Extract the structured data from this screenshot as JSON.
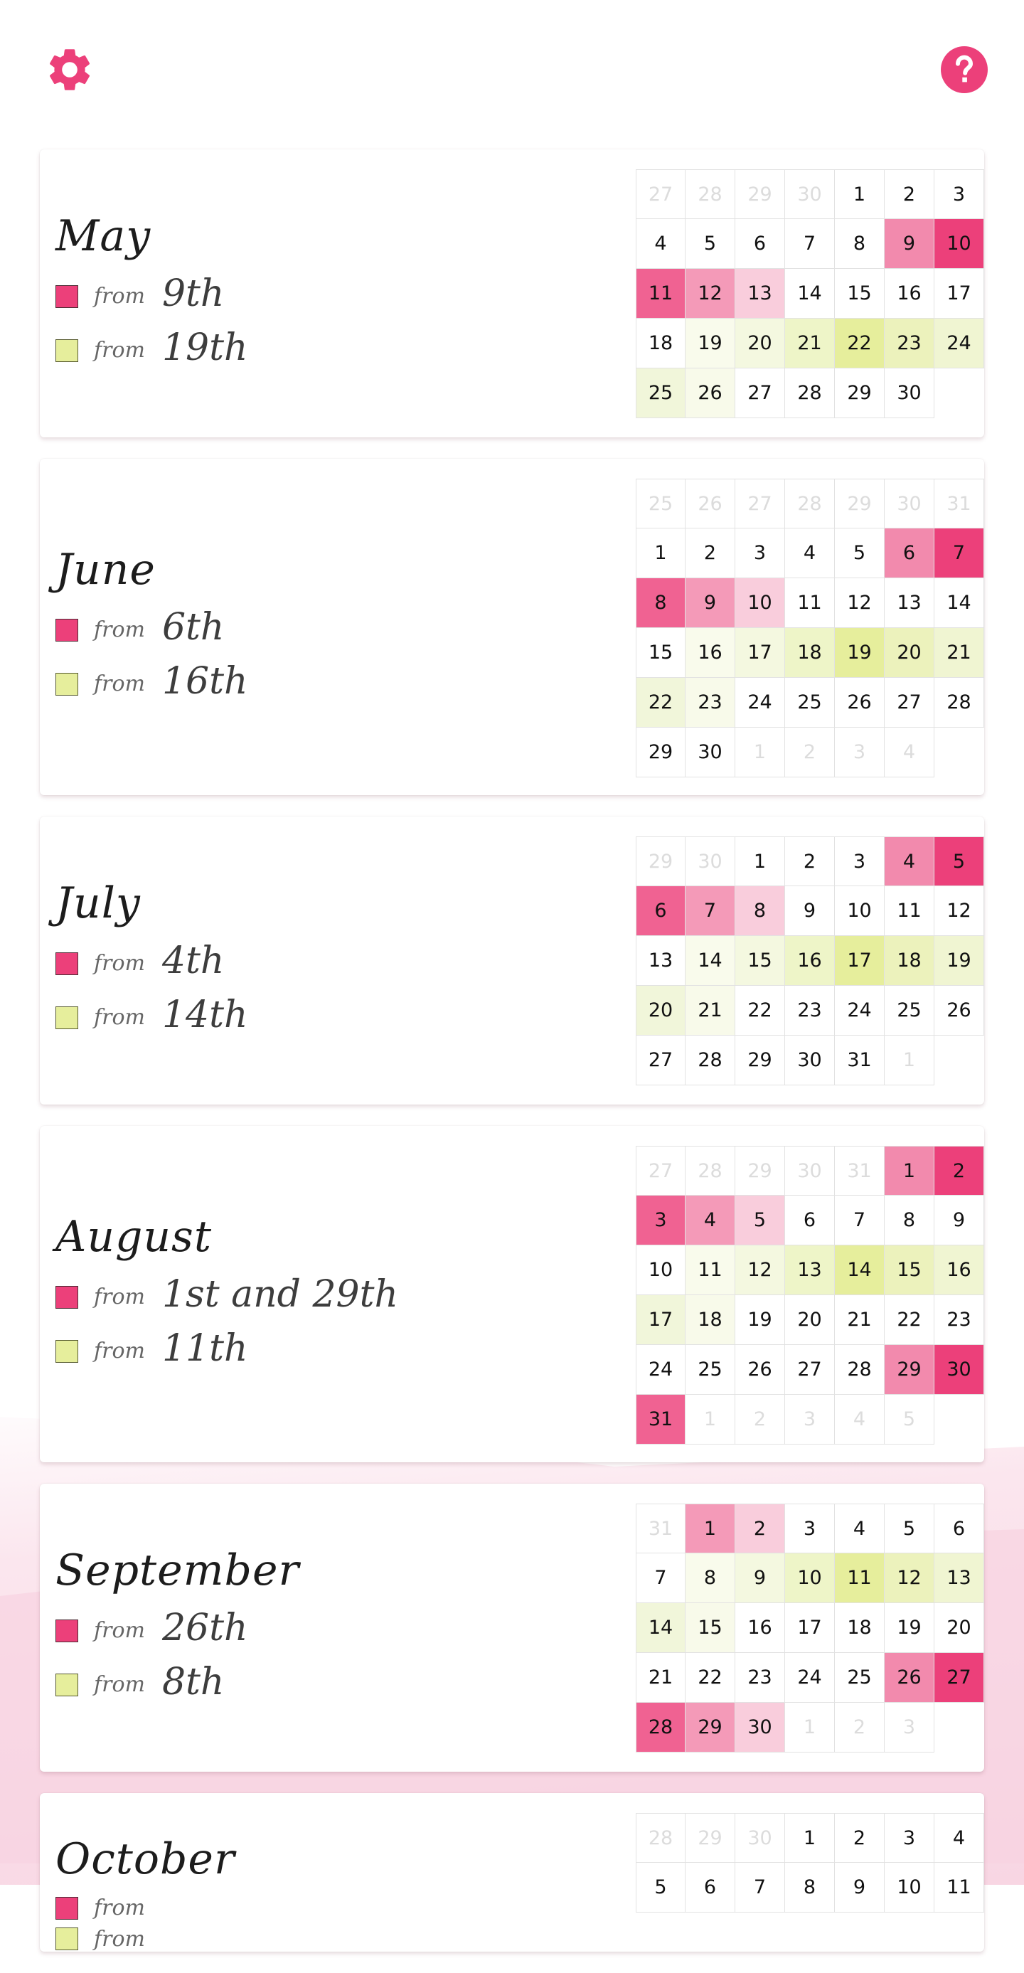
{
  "header": {
    "settings_icon": "gear-icon",
    "help_icon": "help-circle-icon",
    "accent_color": "#ec407a"
  },
  "legend_colors": {
    "pink": "#ec407a",
    "green": "#e6ee9c"
  },
  "from_label": "from",
  "months": [
    {
      "name": "May",
      "pink_from": "9th",
      "green_from": "19th",
      "weeks": [
        [
          [
            "27",
            "o"
          ],
          [
            "28",
            "o"
          ],
          [
            "29",
            "o"
          ],
          [
            "30",
            "o"
          ],
          [
            "1",
            ""
          ],
          [
            "2",
            ""
          ],
          [
            "3",
            ""
          ]
        ],
        [
          [
            "4",
            ""
          ],
          [
            "5",
            ""
          ],
          [
            "6",
            ""
          ],
          [
            "7",
            ""
          ],
          [
            "8",
            ""
          ],
          [
            "9",
            "p1"
          ],
          [
            "10",
            "p2"
          ]
        ],
        [
          [
            "11",
            "p3"
          ],
          [
            "12",
            "p4"
          ],
          [
            "13",
            "p5"
          ],
          [
            "14",
            ""
          ],
          [
            "15",
            ""
          ],
          [
            "16",
            ""
          ],
          [
            "17",
            ""
          ]
        ],
        [
          [
            "18",
            ""
          ],
          [
            "19",
            "g1"
          ],
          [
            "20",
            "g2"
          ],
          [
            "21",
            "g3"
          ],
          [
            "22",
            "g4"
          ],
          [
            "23",
            "g5"
          ],
          [
            "24",
            "g6"
          ]
        ],
        [
          [
            "25",
            "g7"
          ],
          [
            "26",
            "g8"
          ],
          [
            "27",
            ""
          ],
          [
            "28",
            ""
          ],
          [
            "29",
            ""
          ],
          [
            "30",
            ""
          ],
          [
            "",
            "e"
          ]
        ]
      ]
    },
    {
      "name": "June",
      "pink_from": "6th",
      "green_from": "16th",
      "weeks": [
        [
          [
            "25",
            "o"
          ],
          [
            "26",
            "o"
          ],
          [
            "27",
            "o"
          ],
          [
            "28",
            "o"
          ],
          [
            "29",
            "o"
          ],
          [
            "30",
            "o"
          ],
          [
            "31",
            "o"
          ]
        ],
        [
          [
            "1",
            ""
          ],
          [
            "2",
            ""
          ],
          [
            "3",
            ""
          ],
          [
            "4",
            ""
          ],
          [
            "5",
            ""
          ],
          [
            "6",
            "p1"
          ],
          [
            "7",
            "p2"
          ]
        ],
        [
          [
            "8",
            "p3"
          ],
          [
            "9",
            "p4"
          ],
          [
            "10",
            "p5"
          ],
          [
            "11",
            ""
          ],
          [
            "12",
            ""
          ],
          [
            "13",
            ""
          ],
          [
            "14",
            ""
          ]
        ],
        [
          [
            "15",
            ""
          ],
          [
            "16",
            "g1"
          ],
          [
            "17",
            "g2"
          ],
          [
            "18",
            "g3"
          ],
          [
            "19",
            "g4"
          ],
          [
            "20",
            "g5"
          ],
          [
            "21",
            "g6"
          ]
        ],
        [
          [
            "22",
            "g7"
          ],
          [
            "23",
            "g8"
          ],
          [
            "24",
            ""
          ],
          [
            "25",
            ""
          ],
          [
            "26",
            ""
          ],
          [
            "27",
            ""
          ],
          [
            "28",
            ""
          ]
        ],
        [
          [
            "29",
            ""
          ],
          [
            "30",
            ""
          ],
          [
            "1",
            "o"
          ],
          [
            "2",
            "o"
          ],
          [
            "3",
            "o"
          ],
          [
            "4",
            "o"
          ],
          [
            "",
            "e"
          ]
        ]
      ]
    },
    {
      "name": "July",
      "pink_from": "4th",
      "green_from": "14th",
      "weeks": [
        [
          [
            "29",
            "o"
          ],
          [
            "30",
            "o"
          ],
          [
            "1",
            ""
          ],
          [
            "2",
            ""
          ],
          [
            "3",
            ""
          ],
          [
            "4",
            "p1"
          ],
          [
            "5",
            "p2"
          ]
        ],
        [
          [
            "6",
            "p3"
          ],
          [
            "7",
            "p4"
          ],
          [
            "8",
            "p5"
          ],
          [
            "9",
            ""
          ],
          [
            "10",
            ""
          ],
          [
            "11",
            ""
          ],
          [
            "12",
            ""
          ]
        ],
        [
          [
            "13",
            ""
          ],
          [
            "14",
            "g1"
          ],
          [
            "15",
            "g2"
          ],
          [
            "16",
            "g3"
          ],
          [
            "17",
            "g4"
          ],
          [
            "18",
            "g5"
          ],
          [
            "19",
            "g6"
          ]
        ],
        [
          [
            "20",
            "g7"
          ],
          [
            "21",
            "g8"
          ],
          [
            "22",
            ""
          ],
          [
            "23",
            ""
          ],
          [
            "24",
            ""
          ],
          [
            "25",
            ""
          ],
          [
            "26",
            ""
          ]
        ],
        [
          [
            "27",
            ""
          ],
          [
            "28",
            ""
          ],
          [
            "29",
            ""
          ],
          [
            "30",
            ""
          ],
          [
            "31",
            ""
          ],
          [
            "1",
            "o"
          ],
          [
            "",
            "e"
          ]
        ]
      ]
    },
    {
      "name": "August",
      "pink_from": "1st and 29th",
      "green_from": "11th",
      "weeks": [
        [
          [
            "27",
            "o"
          ],
          [
            "28",
            "o"
          ],
          [
            "29",
            "o"
          ],
          [
            "30",
            "o"
          ],
          [
            "31",
            "o"
          ],
          [
            "1",
            "p1"
          ],
          [
            "2",
            "p2"
          ]
        ],
        [
          [
            "3",
            "p3"
          ],
          [
            "4",
            "p4"
          ],
          [
            "5",
            "p5"
          ],
          [
            "6",
            ""
          ],
          [
            "7",
            ""
          ],
          [
            "8",
            ""
          ],
          [
            "9",
            ""
          ]
        ],
        [
          [
            "10",
            ""
          ],
          [
            "11",
            "g1"
          ],
          [
            "12",
            "g2"
          ],
          [
            "13",
            "g3"
          ],
          [
            "14",
            "g4"
          ],
          [
            "15",
            "g5"
          ],
          [
            "16",
            "g6"
          ]
        ],
        [
          [
            "17",
            "g7"
          ],
          [
            "18",
            "g8"
          ],
          [
            "19",
            ""
          ],
          [
            "20",
            ""
          ],
          [
            "21",
            ""
          ],
          [
            "22",
            ""
          ],
          [
            "23",
            ""
          ]
        ],
        [
          [
            "24",
            ""
          ],
          [
            "25",
            ""
          ],
          [
            "26",
            ""
          ],
          [
            "27",
            ""
          ],
          [
            "28",
            ""
          ],
          [
            "29",
            "p1"
          ],
          [
            "30",
            "p2"
          ]
        ],
        [
          [
            "31",
            "p3"
          ],
          [
            "1",
            "o"
          ],
          [
            "2",
            "o"
          ],
          [
            "3",
            "o"
          ],
          [
            "4",
            "o"
          ],
          [
            "5",
            "o"
          ],
          [
            "",
            "e"
          ]
        ]
      ]
    },
    {
      "name": "September",
      "pink_from": "26th",
      "green_from": "8th",
      "weeks": [
        [
          [
            "31",
            "o"
          ],
          [
            "1",
            "p4"
          ],
          [
            "2",
            "p5"
          ],
          [
            "3",
            ""
          ],
          [
            "4",
            ""
          ],
          [
            "5",
            ""
          ],
          [
            "6",
            ""
          ]
        ],
        [
          [
            "7",
            ""
          ],
          [
            "8",
            "g1"
          ],
          [
            "9",
            "g2"
          ],
          [
            "10",
            "g3"
          ],
          [
            "11",
            "g4"
          ],
          [
            "12",
            "g5"
          ],
          [
            "13",
            "g6"
          ]
        ],
        [
          [
            "14",
            "g7"
          ],
          [
            "15",
            "g8"
          ],
          [
            "16",
            ""
          ],
          [
            "17",
            ""
          ],
          [
            "18",
            ""
          ],
          [
            "19",
            ""
          ],
          [
            "20",
            ""
          ]
        ],
        [
          [
            "21",
            ""
          ],
          [
            "22",
            ""
          ],
          [
            "23",
            ""
          ],
          [
            "24",
            ""
          ],
          [
            "25",
            ""
          ],
          [
            "26",
            "p1"
          ],
          [
            "27",
            "p2"
          ]
        ],
        [
          [
            "28",
            "p3"
          ],
          [
            "29",
            "p4"
          ],
          [
            "30",
            "p5"
          ],
          [
            "1",
            "o"
          ],
          [
            "2",
            "o"
          ],
          [
            "3",
            "o"
          ],
          [
            "",
            "e"
          ]
        ]
      ]
    },
    {
      "name": "October",
      "pink_from": "",
      "green_from": "",
      "weeks": [
        [
          [
            "28",
            "o"
          ],
          [
            "29",
            "o"
          ],
          [
            "30",
            "o"
          ],
          [
            "1",
            ""
          ],
          [
            "2",
            ""
          ],
          [
            "3",
            ""
          ],
          [
            "4",
            ""
          ]
        ],
        [
          [
            "5",
            ""
          ],
          [
            "6",
            ""
          ],
          [
            "7",
            ""
          ],
          [
            "8",
            ""
          ],
          [
            "9",
            ""
          ],
          [
            "10",
            ""
          ],
          [
            "11",
            ""
          ]
        ]
      ]
    }
  ]
}
